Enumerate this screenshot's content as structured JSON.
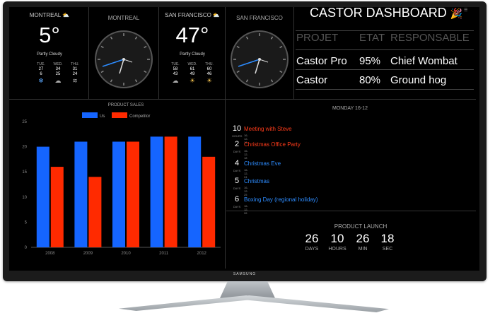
{
  "device": {
    "brand": "SAMSUNG"
  },
  "weather": [
    {
      "city": "MONTREAL",
      "temp": "5°",
      "desc": "Partly Cloudy",
      "forecast": [
        {
          "day": "TUE.",
          "hi": "27",
          "lo": "6",
          "icon": "❄"
        },
        {
          "day": "WED.",
          "hi": "34",
          "lo": "25",
          "icon": "☁"
        },
        {
          "day": "THU.",
          "hi": "31",
          "lo": "24",
          "icon": "≋"
        }
      ]
    },
    {
      "city": "SAN FRANCISCO",
      "temp": "47°",
      "desc": "Partly Cloudy",
      "forecast": [
        {
          "day": "TUE.",
          "hi": "58",
          "lo": "43",
          "icon": "☁"
        },
        {
          "day": "WED.",
          "hi": "61",
          "lo": "49",
          "icon": "☀"
        },
        {
          "day": "THU.",
          "hi": "60",
          "lo": "46",
          "icon": "☀"
        }
      ]
    }
  ],
  "clocks": [
    {
      "city": "MONTREAL"
    },
    {
      "city": "SAN FRANCISCO"
    }
  ],
  "dashboard": {
    "title": "CASTOR DASHBOARD",
    "headers": [
      "PROJET",
      "ETAT",
      "RESPONSABLE"
    ],
    "rows": [
      [
        "Castor Pro",
        "95%",
        "Chief Wombat"
      ],
      [
        "Castor",
        "80%",
        "Ground hog"
      ]
    ]
  },
  "chart_data": {
    "type": "bar",
    "title": "PRODUCT SALES",
    "categories": [
      "2008",
      "2009",
      "2010",
      "2011",
      "2012"
    ],
    "series": [
      {
        "name": "Us",
        "color": "#1565ff",
        "values": [
          20,
          21,
          21,
          22,
          22
        ]
      },
      {
        "name": "Competitor",
        "color": "#ff2a00",
        "values": [
          16,
          14,
          21,
          22,
          18
        ]
      }
    ],
    "ylim": [
      0,
      25
    ],
    "yticks": [
      0,
      5,
      10,
      15,
      20,
      25
    ],
    "legend": "top-center",
    "grid": false
  },
  "calendar": {
    "title": "MONDAY 16-12",
    "events": [
      {
        "num": "10",
        "unit": "HOURS",
        "title": "Meeting with Steve",
        "date": "16-12-16",
        "color": "#ff3b1a"
      },
      {
        "num": "2",
        "unit": "DAYS",
        "title": "Christmas Office Party",
        "date": "16-12-18",
        "color": "#ff3b1a"
      },
      {
        "num": "4",
        "unit": "DAYS",
        "title": "Christmas Eve",
        "date": "16-12-24",
        "color": "#2d8cff"
      },
      {
        "num": "5",
        "unit": "DAYS",
        "title": "Christmas",
        "date": "16-12-25",
        "color": "#2d8cff"
      },
      {
        "num": "6",
        "unit": "DAYS",
        "title": "Boxing Day (regional holiday)",
        "date": "16-12-26",
        "color": "#2d8cff"
      }
    ]
  },
  "countdown": {
    "title": "PRODUCT LAUNCH",
    "items": [
      {
        "value": "26",
        "unit": "DAYS"
      },
      {
        "value": "10",
        "unit": "HOURS"
      },
      {
        "value": "26",
        "unit": "MIN"
      },
      {
        "value": "18",
        "unit": "SEC"
      }
    ]
  }
}
